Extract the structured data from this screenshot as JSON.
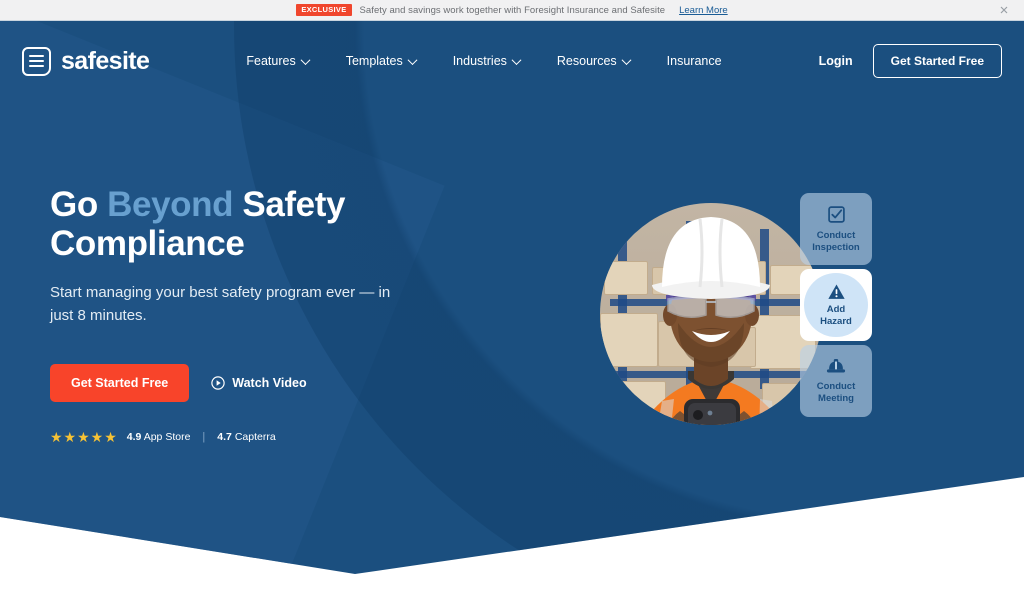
{
  "promo": {
    "badge": "EXCLUSIVE",
    "text": "Safety and savings work together with Foresight Insurance and Safesite",
    "link": "Learn More",
    "close_icon": "close-icon",
    "badge_color": "#f0462d"
  },
  "header": {
    "brand": "safesite",
    "brand_icon": "safesite-logo-icon",
    "nav": [
      {
        "label": "Features",
        "has_dropdown": true
      },
      {
        "label": "Templates",
        "has_dropdown": true
      },
      {
        "label": "Industries",
        "has_dropdown": true
      },
      {
        "label": "Resources",
        "has_dropdown": true
      },
      {
        "label": "Insurance",
        "has_dropdown": false
      }
    ],
    "login": "Login",
    "cta": "Get Started Free"
  },
  "hero": {
    "headline_1": "Go ",
    "headline_accent": "Beyond",
    "headline_2": " Safety",
    "headline_3": "Compliance",
    "subhead": "Start managing your best safety program ever — in just 8 minutes.",
    "cta_primary": "Get Started Free",
    "watch_video": "Watch Video",
    "watch_icon": "play-circle-icon",
    "stars": "★★★★★",
    "rating_appstore_score": "4.9",
    "rating_appstore_label": "App Store",
    "rating_separator": "|",
    "rating_capterra_score": "4.7",
    "rating_capterra_label": "Capterra",
    "accent_color": "#68a0cf",
    "background_color": "#1b4f7f",
    "cta_color": "#f8442a",
    "star_color": "#f5c235"
  },
  "action_cards": [
    {
      "id": "conduct-inspection",
      "line1": "Conduct",
      "line2": "Inspection",
      "icon": "checkbox-icon",
      "style": "translucent"
    },
    {
      "id": "add-hazard",
      "line1": "Add",
      "line2": "Hazard",
      "icon": "warning-triangle-icon",
      "style": "white"
    },
    {
      "id": "conduct-meeting",
      "line1": "Conduct",
      "line2": "Meeting",
      "icon": "hard-hat-icon",
      "style": "translucent"
    }
  ],
  "photo": {
    "alt": "Construction worker in white hard hat and orange hi-vis vest using a phone in a warehouse"
  }
}
